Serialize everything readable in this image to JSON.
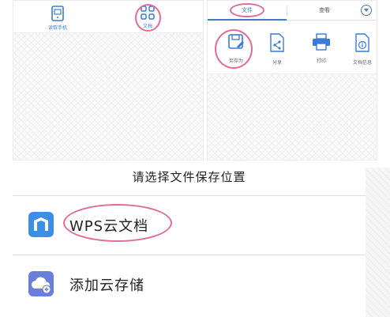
{
  "left_panel": {
    "items": [
      {
        "label": "读取手机",
        "icon": "tablet-icon"
      },
      {
        "label": "文档",
        "icon": "grid-apps-icon"
      }
    ]
  },
  "right_panel": {
    "tabs": [
      {
        "label": "文件",
        "active": true
      },
      {
        "label": "查看",
        "active": false
      }
    ],
    "dropdown_icon": "chevron-down-circle-icon",
    "tools": [
      {
        "label": "另存为",
        "icon": "save-as-icon"
      },
      {
        "label": "分享",
        "icon": "share-icon"
      },
      {
        "label": "打印",
        "icon": "printer-icon"
      },
      {
        "label": "文档信息",
        "icon": "info-document-icon"
      }
    ]
  },
  "sheet": {
    "title": "请选择文件保存位置",
    "options": [
      {
        "label": "WPS云文档",
        "icon": "wps-cloud-icon",
        "color": "#3d8fe6"
      },
      {
        "label": "添加云存储",
        "icon": "add-cloud-icon",
        "color": "#6a7fd8"
      }
    ]
  },
  "colors": {
    "accent": "#3b7bd6",
    "annotation": "#e06c9a"
  }
}
